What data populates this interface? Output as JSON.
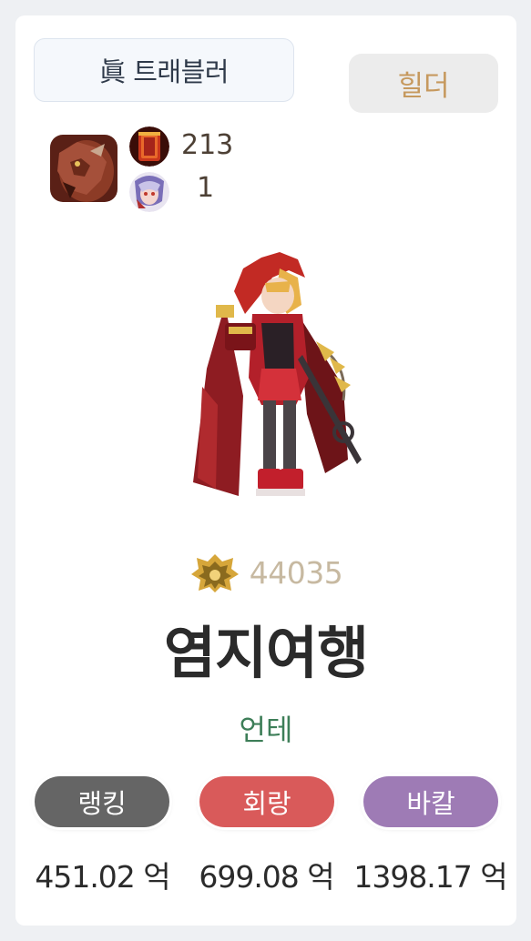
{
  "class_title": "眞 트래블러",
  "role_label": "힐더",
  "icons": {
    "pet": "pet-creature-icon",
    "item1": "red-armor-icon",
    "item2": "creature-portrait-icon",
    "fame": "gold-crest-icon"
  },
  "counts": [
    "213",
    "1"
  ],
  "fame_value": "44035",
  "character_name": "염지여행",
  "adventure_name": "언테",
  "stats": [
    {
      "label": "랭킹",
      "value": "451.02 억",
      "color": "#656565"
    },
    {
      "label": "회랑",
      "value": "699.08 억",
      "color": "#d95a5a"
    },
    {
      "label": "바칼",
      "value": "1398.17 억",
      "color": "#9e7bb5"
    }
  ]
}
